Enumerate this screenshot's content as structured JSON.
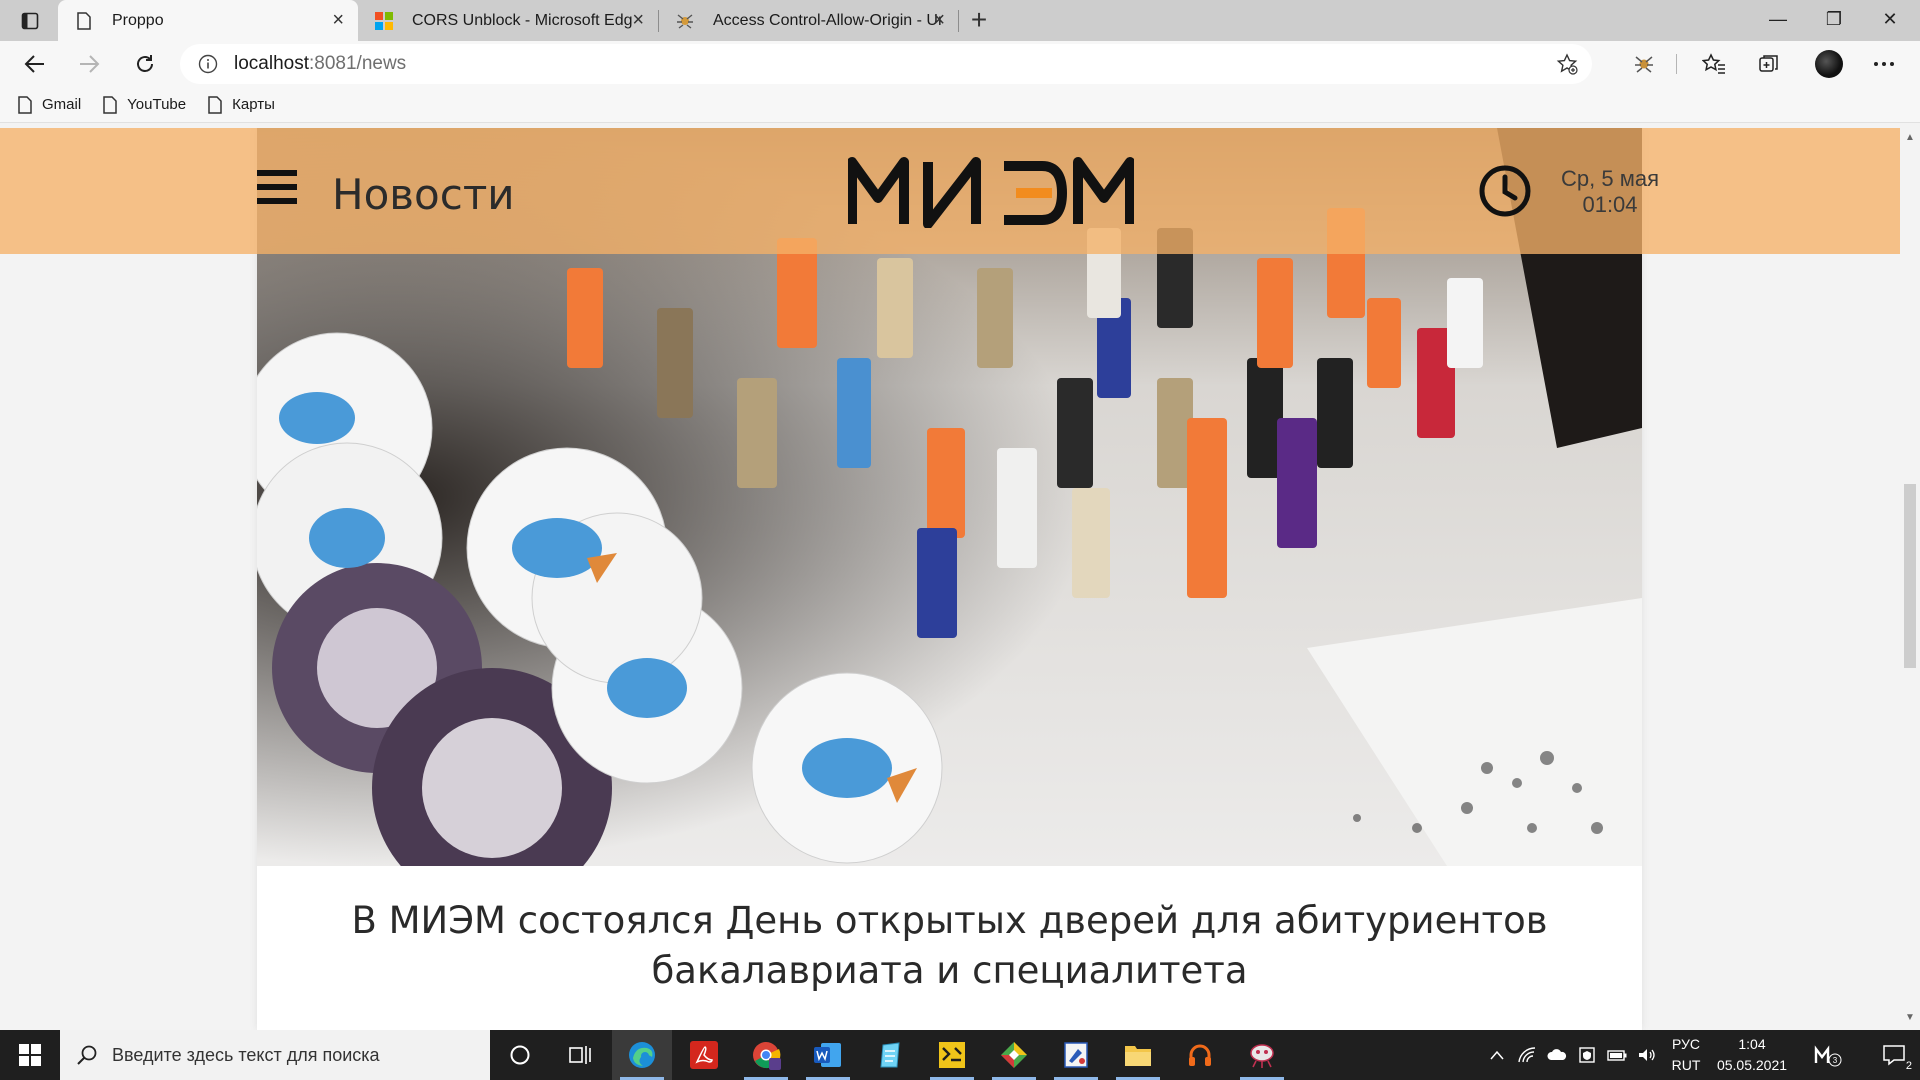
{
  "browser": {
    "tabs": [
      {
        "title": "Proppo",
        "favicon": "page-icon",
        "active": true
      },
      {
        "title": "CORS Unblock - Microsoft Edge",
        "favicon": "microsoft-logo-icon",
        "active": false
      },
      {
        "title": "Access Control-Allow-Origin - Un",
        "favicon": "extension-bug-icon",
        "active": false
      }
    ],
    "new_tab_label": "+",
    "window_controls": {
      "minimize": "—",
      "restore": "❐",
      "close": "✕"
    },
    "address": {
      "host": "localhost",
      "rest": ":8081/news"
    },
    "bookmarks": [
      "Gmail",
      "YouTube",
      "Карты"
    ]
  },
  "site": {
    "section_title": "Новости",
    "logo_text": "МИЭМ",
    "date_line1": "Ср, 5 мая",
    "date_line2": "01:04",
    "header_color": "#f5b168"
  },
  "article": {
    "title": "В МИЭМ состоялся День открытых дверей для абитуриентов бакалавриата и специалитета"
  },
  "taskbar": {
    "search_placeholder": "Введите здесь текст для поиска",
    "lang_line1": "РУС",
    "lang_line2": "RUT",
    "time": "1:04",
    "date": "05.05.2021",
    "notifications_count": "2",
    "apps": [
      "cortana-icon",
      "task-view-icon",
      "edge-icon",
      "acrobat-icon",
      "chrome-icon",
      "word-icon",
      "notepad-icon",
      "yellow-app-icon",
      "diamond-app-icon",
      "paint-icon",
      "file-explorer-icon",
      "headphones-app-icon",
      "bug-app-icon"
    ]
  }
}
